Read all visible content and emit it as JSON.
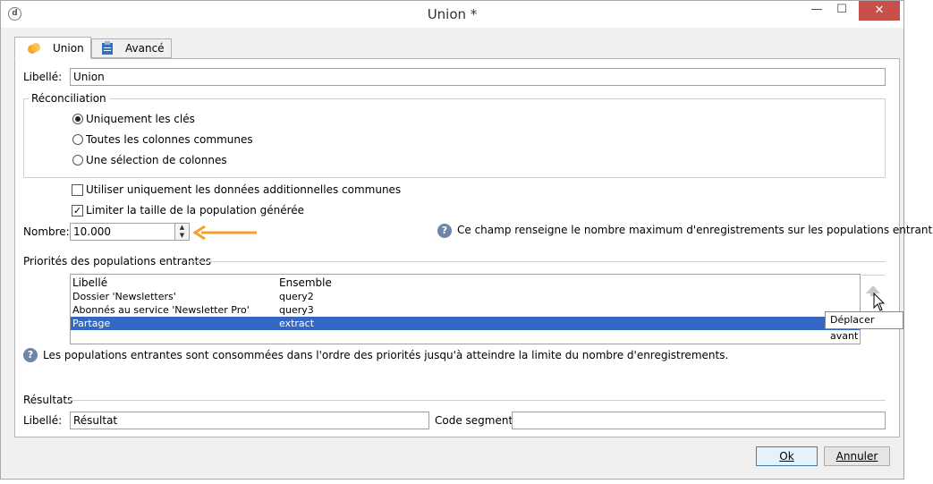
{
  "window": {
    "title": "Union *",
    "icon_name": "workflow-app-icon",
    "controls": {
      "minimize": "—",
      "maximize": "☐",
      "close": "✕"
    }
  },
  "tabs": [
    {
      "label": "Union",
      "icon": "union-circles-icon",
      "active": true
    },
    {
      "label": "Avancé",
      "icon": "clipboard-icon",
      "active": false
    }
  ],
  "form": {
    "libelle_label": "Libellé:",
    "libelle_value": "Union",
    "reconciliation": {
      "title": "Réconciliation",
      "options": [
        {
          "label": "Uniquement les clés",
          "selected": true
        },
        {
          "label": "Toutes les colonnes communes",
          "selected": false
        },
        {
          "label": "Une sélection de colonnes",
          "selected": false
        }
      ]
    },
    "checkbox_additional": {
      "label": "Utiliser uniquement les données additionnelles communes",
      "checked": false
    },
    "checkbox_limit": {
      "label": "Limiter la taille de la population générée",
      "checked": true
    },
    "nombre_label": "Nombre:",
    "nombre_value": "10.000",
    "nombre_help": "Ce champ renseigne le nombre maximum d'enregistrements sur les populations entrantes.",
    "priorities": {
      "title": "Priorités des populations entrantes",
      "columns": [
        "Libellé",
        "Ensemble"
      ],
      "rows": [
        {
          "libelle": "Dossier 'Newsletters'",
          "ensemble": "query2",
          "selected": false
        },
        {
          "libelle": "Abonnés au service 'Newsletter Pro'",
          "ensemble": "query3",
          "selected": false
        },
        {
          "libelle": "Partage",
          "ensemble": "extract",
          "selected": true
        }
      ],
      "tooltip": "Déplacer avant",
      "help_text": "Les populations entrantes sont consommées dans l'ordre des priorités jusqu'à atteindre la limite du nombre d'enregistrements."
    },
    "resultats": {
      "title": "Résultats",
      "libelle_label": "Libellé:",
      "libelle_value": "Résultat",
      "code_segment_label": "Code segment:",
      "code_segment_value": ""
    }
  },
  "buttons": {
    "ok": "Ok",
    "annuler": "Annuler"
  },
  "colors": {
    "selection": "#3468c4",
    "arrow": "#f5a02a",
    "close_button": "#c7504a"
  }
}
